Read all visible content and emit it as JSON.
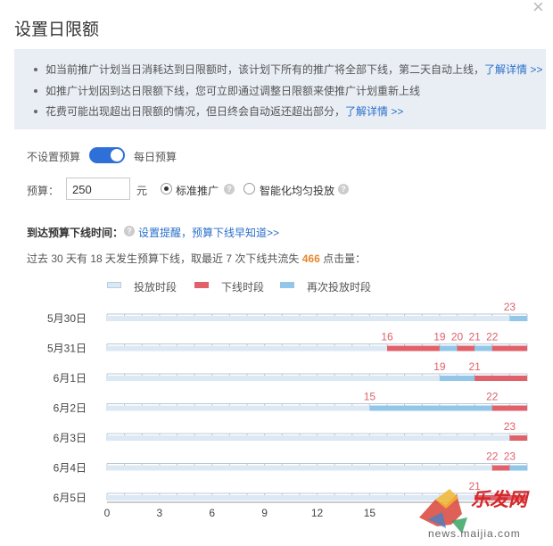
{
  "dialog": {
    "title": "设置日限额",
    "close_symbol": "×"
  },
  "info": {
    "line1_text": "如当前推广计划当日消耗达到日限额时，该计划下所有的推广将全部下线，第二天自动上线，",
    "line1_link": "了解详情 >>",
    "line2_text": "如推广计划因到达日限额下线，您可立即通过调整日限额来使推广计划重新上线",
    "line3_text": "花费可能出现超出日限额的情况，但日终会自动返还超出部分，",
    "line3_link": "了解详情 >>"
  },
  "budget": {
    "no_budget_label": "不设置预算",
    "daily_budget_label": "每日预算",
    "budget_label": "预算：",
    "value": "250",
    "unit": "元",
    "standard_label": "标准推广",
    "smart_label": "智能化均匀投放"
  },
  "offline": {
    "title": "到达预算下线时间：",
    "link": "设置提醒，预算下线早知道>>",
    "summary_prefix": "过去 30 天有 18 天发生预算下线，取最近 7 次下线共流失",
    "summary_number": "466",
    "summary_suffix": "点击量："
  },
  "colors": {
    "serving": "#dce9f5",
    "offline": "#e0616a",
    "reserving": "#92c7ea",
    "toggle": "#2e6fd8",
    "link": "#2a6fc9"
  },
  "chart_data": {
    "type": "gantt",
    "legend": [
      "投放时段",
      "下线时段",
      "再次投放时段"
    ],
    "x_ticks": [
      "0",
      "3",
      "6",
      "9",
      "12",
      "15"
    ],
    "xlim": [
      0,
      24
    ],
    "days": [
      {
        "label": "5月30日",
        "segments": [
          {
            "start": 0,
            "end": 23,
            "state": "serving"
          },
          {
            "start": 23,
            "end": 24,
            "state": "reserving"
          }
        ],
        "markers": [
          "23"
        ],
        "marker_hours": [
          23
        ]
      },
      {
        "label": "5月31日",
        "segments": [
          {
            "start": 0,
            "end": 16,
            "state": "serving"
          },
          {
            "start": 16,
            "end": 19,
            "state": "offline"
          },
          {
            "start": 19,
            "end": 20,
            "state": "reserving"
          },
          {
            "start": 20,
            "end": 21,
            "state": "offline"
          },
          {
            "start": 21,
            "end": 22,
            "state": "reserving"
          },
          {
            "start": 22,
            "end": 24,
            "state": "offline"
          }
        ],
        "markers": [
          "16",
          "19",
          "20",
          "21",
          "22"
        ],
        "marker_hours": [
          16,
          19,
          20,
          21,
          22
        ]
      },
      {
        "label": "6月1日",
        "segments": [
          {
            "start": 0,
            "end": 19,
            "state": "serving"
          },
          {
            "start": 19,
            "end": 21,
            "state": "reserving"
          },
          {
            "start": 21,
            "end": 24,
            "state": "offline"
          }
        ],
        "markers": [
          "19",
          "21"
        ],
        "marker_hours": [
          19,
          21
        ]
      },
      {
        "label": "6月2日",
        "segments": [
          {
            "start": 0,
            "end": 15,
            "state": "serving"
          },
          {
            "start": 15,
            "end": 22,
            "state": "reserving"
          },
          {
            "start": 22,
            "end": 24,
            "state": "offline"
          }
        ],
        "markers": [
          "15",
          "22"
        ],
        "marker_hours": [
          15,
          22
        ]
      },
      {
        "label": "6月3日",
        "segments": [
          {
            "start": 0,
            "end": 23,
            "state": "serving"
          },
          {
            "start": 23,
            "end": 24,
            "state": "offline"
          }
        ],
        "markers": [
          "23"
        ],
        "marker_hours": [
          23
        ]
      },
      {
        "label": "6月4日",
        "segments": [
          {
            "start": 0,
            "end": 22,
            "state": "serving"
          },
          {
            "start": 22,
            "end": 23,
            "state": "offline"
          },
          {
            "start": 23,
            "end": 24,
            "state": "reserving"
          }
        ],
        "markers": [
          "22",
          "23"
        ],
        "marker_hours": [
          22,
          23
        ]
      },
      {
        "label": "6月5日",
        "segments": [
          {
            "start": 0,
            "end": 21,
            "state": "serving"
          },
          {
            "start": 21,
            "end": 24,
            "state": "offline"
          }
        ],
        "markers": [
          "21"
        ],
        "marker_hours": [
          21
        ]
      }
    ]
  },
  "watermark": {
    "brand": "乐发网",
    "url": "news.maijia.com"
  }
}
